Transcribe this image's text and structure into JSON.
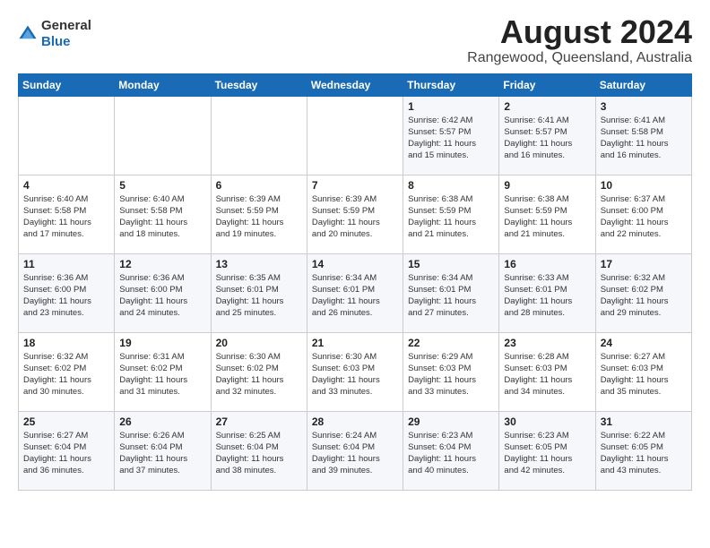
{
  "logo": {
    "text_general": "General",
    "text_blue": "Blue"
  },
  "header": {
    "month": "August 2024",
    "location": "Rangewood, Queensland, Australia"
  },
  "weekdays": [
    "Sunday",
    "Monday",
    "Tuesday",
    "Wednesday",
    "Thursday",
    "Friday",
    "Saturday"
  ],
  "weeks": [
    [
      {
        "day": "",
        "info": ""
      },
      {
        "day": "",
        "info": ""
      },
      {
        "day": "",
        "info": ""
      },
      {
        "day": "",
        "info": ""
      },
      {
        "day": "1",
        "info": "Sunrise: 6:42 AM\nSunset: 5:57 PM\nDaylight: 11 hours\nand 15 minutes."
      },
      {
        "day": "2",
        "info": "Sunrise: 6:41 AM\nSunset: 5:57 PM\nDaylight: 11 hours\nand 16 minutes."
      },
      {
        "day": "3",
        "info": "Sunrise: 6:41 AM\nSunset: 5:58 PM\nDaylight: 11 hours\nand 16 minutes."
      }
    ],
    [
      {
        "day": "4",
        "info": "Sunrise: 6:40 AM\nSunset: 5:58 PM\nDaylight: 11 hours\nand 17 minutes."
      },
      {
        "day": "5",
        "info": "Sunrise: 6:40 AM\nSunset: 5:58 PM\nDaylight: 11 hours\nand 18 minutes."
      },
      {
        "day": "6",
        "info": "Sunrise: 6:39 AM\nSunset: 5:59 PM\nDaylight: 11 hours\nand 19 minutes."
      },
      {
        "day": "7",
        "info": "Sunrise: 6:39 AM\nSunset: 5:59 PM\nDaylight: 11 hours\nand 20 minutes."
      },
      {
        "day": "8",
        "info": "Sunrise: 6:38 AM\nSunset: 5:59 PM\nDaylight: 11 hours\nand 21 minutes."
      },
      {
        "day": "9",
        "info": "Sunrise: 6:38 AM\nSunset: 5:59 PM\nDaylight: 11 hours\nand 21 minutes."
      },
      {
        "day": "10",
        "info": "Sunrise: 6:37 AM\nSunset: 6:00 PM\nDaylight: 11 hours\nand 22 minutes."
      }
    ],
    [
      {
        "day": "11",
        "info": "Sunrise: 6:36 AM\nSunset: 6:00 PM\nDaylight: 11 hours\nand 23 minutes."
      },
      {
        "day": "12",
        "info": "Sunrise: 6:36 AM\nSunset: 6:00 PM\nDaylight: 11 hours\nand 24 minutes."
      },
      {
        "day": "13",
        "info": "Sunrise: 6:35 AM\nSunset: 6:01 PM\nDaylight: 11 hours\nand 25 minutes."
      },
      {
        "day": "14",
        "info": "Sunrise: 6:34 AM\nSunset: 6:01 PM\nDaylight: 11 hours\nand 26 minutes."
      },
      {
        "day": "15",
        "info": "Sunrise: 6:34 AM\nSunset: 6:01 PM\nDaylight: 11 hours\nand 27 minutes."
      },
      {
        "day": "16",
        "info": "Sunrise: 6:33 AM\nSunset: 6:01 PM\nDaylight: 11 hours\nand 28 minutes."
      },
      {
        "day": "17",
        "info": "Sunrise: 6:32 AM\nSunset: 6:02 PM\nDaylight: 11 hours\nand 29 minutes."
      }
    ],
    [
      {
        "day": "18",
        "info": "Sunrise: 6:32 AM\nSunset: 6:02 PM\nDaylight: 11 hours\nand 30 minutes."
      },
      {
        "day": "19",
        "info": "Sunrise: 6:31 AM\nSunset: 6:02 PM\nDaylight: 11 hours\nand 31 minutes."
      },
      {
        "day": "20",
        "info": "Sunrise: 6:30 AM\nSunset: 6:02 PM\nDaylight: 11 hours\nand 32 minutes."
      },
      {
        "day": "21",
        "info": "Sunrise: 6:30 AM\nSunset: 6:03 PM\nDaylight: 11 hours\nand 33 minutes."
      },
      {
        "day": "22",
        "info": "Sunrise: 6:29 AM\nSunset: 6:03 PM\nDaylight: 11 hours\nand 33 minutes."
      },
      {
        "day": "23",
        "info": "Sunrise: 6:28 AM\nSunset: 6:03 PM\nDaylight: 11 hours\nand 34 minutes."
      },
      {
        "day": "24",
        "info": "Sunrise: 6:27 AM\nSunset: 6:03 PM\nDaylight: 11 hours\nand 35 minutes."
      }
    ],
    [
      {
        "day": "25",
        "info": "Sunrise: 6:27 AM\nSunset: 6:04 PM\nDaylight: 11 hours\nand 36 minutes."
      },
      {
        "day": "26",
        "info": "Sunrise: 6:26 AM\nSunset: 6:04 PM\nDaylight: 11 hours\nand 37 minutes."
      },
      {
        "day": "27",
        "info": "Sunrise: 6:25 AM\nSunset: 6:04 PM\nDaylight: 11 hours\nand 38 minutes."
      },
      {
        "day": "28",
        "info": "Sunrise: 6:24 AM\nSunset: 6:04 PM\nDaylight: 11 hours\nand 39 minutes."
      },
      {
        "day": "29",
        "info": "Sunrise: 6:23 AM\nSunset: 6:04 PM\nDaylight: 11 hours\nand 40 minutes."
      },
      {
        "day": "30",
        "info": "Sunrise: 6:23 AM\nSunset: 6:05 PM\nDaylight: 11 hours\nand 42 minutes."
      },
      {
        "day": "31",
        "info": "Sunrise: 6:22 AM\nSunset: 6:05 PM\nDaylight: 11 hours\nand 43 minutes."
      }
    ]
  ]
}
